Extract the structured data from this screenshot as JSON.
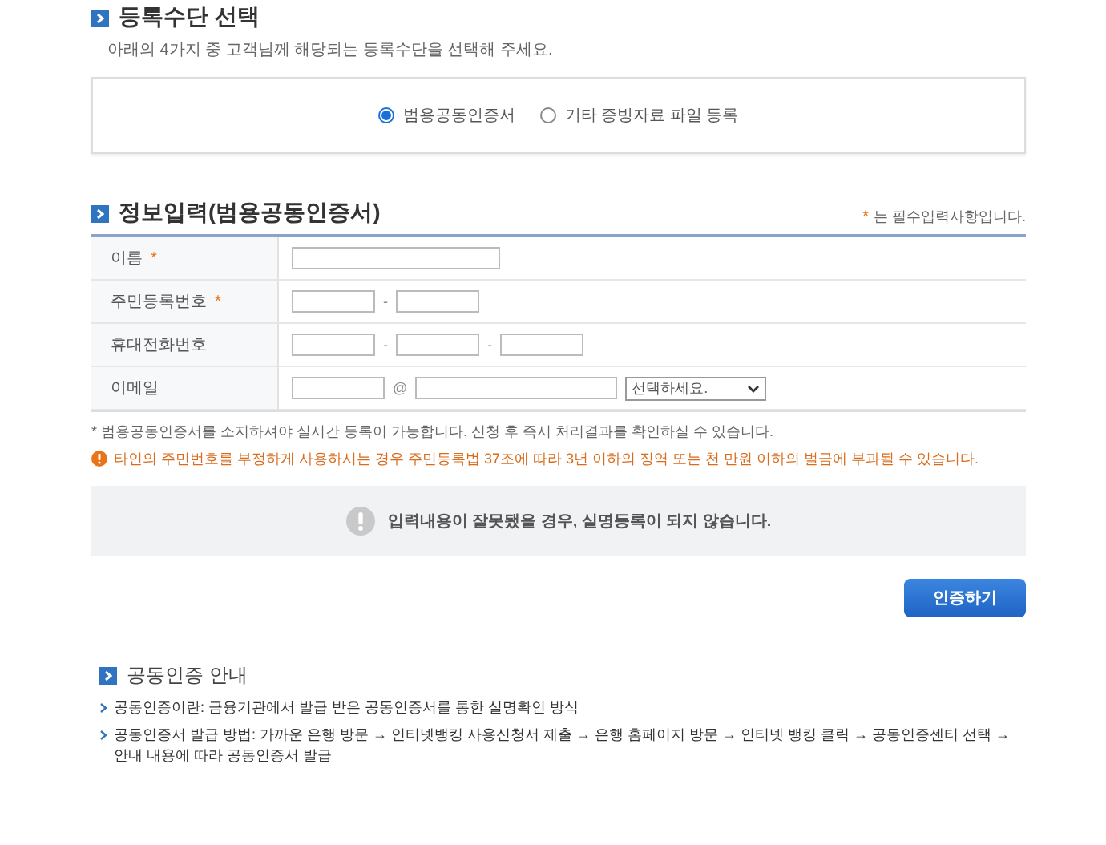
{
  "method_section": {
    "title": "등록수단 선택",
    "description": "아래의 4가지 중 고객님께 해당되는 등록수단을 선택해 주세요.",
    "options": [
      {
        "label": "범용공동인증서",
        "selected": true
      },
      {
        "label": "기타 증빙자료 파일 등록",
        "selected": false
      }
    ]
  },
  "info_section": {
    "title": "정보입력(범용공동인증서)",
    "required_mark": "*",
    "required_note": "는 필수입력사항입니다.",
    "rows": [
      {
        "label": "이름",
        "required": true,
        "inputs": [
          {
            "kind": "input"
          }
        ]
      },
      {
        "label": "주민등록번호",
        "required": true,
        "inputs": [
          {
            "kind": "input"
          },
          {
            "kind": "separator",
            "text": "-"
          },
          {
            "kind": "input"
          }
        ]
      },
      {
        "label": "휴대전화번호",
        "required": false,
        "inputs": [
          {
            "kind": "input"
          },
          {
            "kind": "separator",
            "text": "-"
          },
          {
            "kind": "input"
          },
          {
            "kind": "separator",
            "text": "-"
          },
          {
            "kind": "input"
          }
        ]
      },
      {
        "label": "이메일",
        "required": false,
        "inputs": [
          {
            "kind": "input"
          },
          {
            "kind": "separator",
            "text": "@"
          },
          {
            "kind": "input"
          },
          {
            "kind": "select",
            "value": "선택하세요."
          }
        ]
      }
    ],
    "note": "* 범용공동인증서를 소지하셔야 실시간 등록이 가능합니다. 신청 후 즉시 처리결과를 확인하실 수 있습니다.",
    "warning": "타인의 주민번호를 부정하게 사용하시는 경우 주민등록법 37조에 따라 3년 이하의 징역 또는 천 만원 이하의 벌금에 부과될 수 있습니다.",
    "alert": "입력내용이 잘못됐을 경우, 실명등록이 되지 않습니다.",
    "submit_button": "인증하기"
  },
  "guide_section": {
    "title": "공동인증 안내",
    "items": [
      "공동인증이란: 금융기관에서 발급 받은 공동인증서를 통한 실명확인 방식",
      "공동인증서 발급 방법: 가까운 은행 방문 → 인터넷뱅킹 사용신청서 제출 → 은행 홈페이지 방문 → 인터넷 뱅킹 클릭 → 공동인증센터 선택 → 안내 내용에 따라 공동인증서 발급"
    ]
  }
}
